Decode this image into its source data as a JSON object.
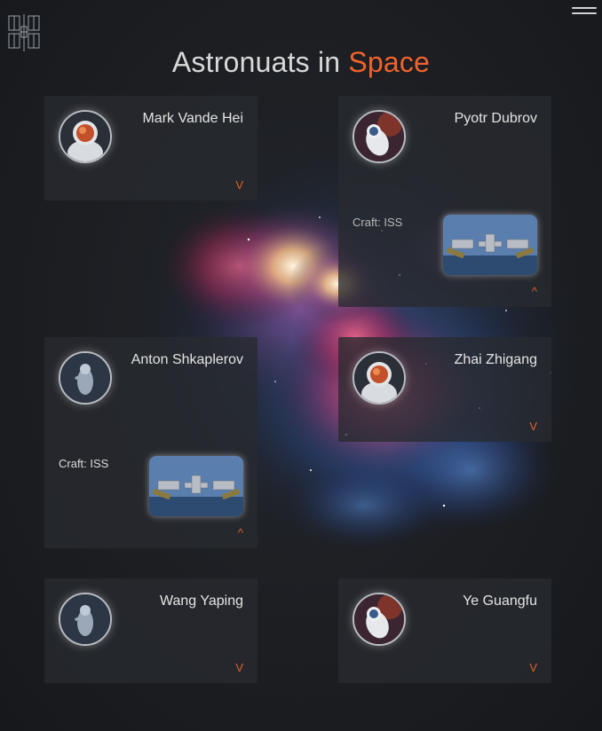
{
  "header": {
    "title_main": "Astronuats in ",
    "title_accent": "Space",
    "logo_icon": "space-station-logo-icon",
    "menu_icon": "hamburger-menu-icon"
  },
  "colors": {
    "accent": "#f0622c",
    "background": "#1b1d21",
    "card": "#2a2c31"
  },
  "astronauts": [
    {
      "name": "Mark Vande Hei",
      "toggle": "V",
      "expanded": false
    },
    {
      "name": "Pyotr Dubrov",
      "toggle": "^",
      "expanded": true,
      "craft": "Craft: ISS"
    },
    {
      "name": "Anton Shkaplerov",
      "toggle": "^",
      "expanded": true,
      "craft": "Craft: ISS"
    },
    {
      "name": "Zhai Zhigang",
      "toggle": "V",
      "expanded": false
    },
    {
      "name": "Wang Yaping",
      "toggle": "V",
      "expanded": false
    },
    {
      "name": "Ye Guangfu",
      "toggle": "V",
      "expanded": false
    }
  ]
}
